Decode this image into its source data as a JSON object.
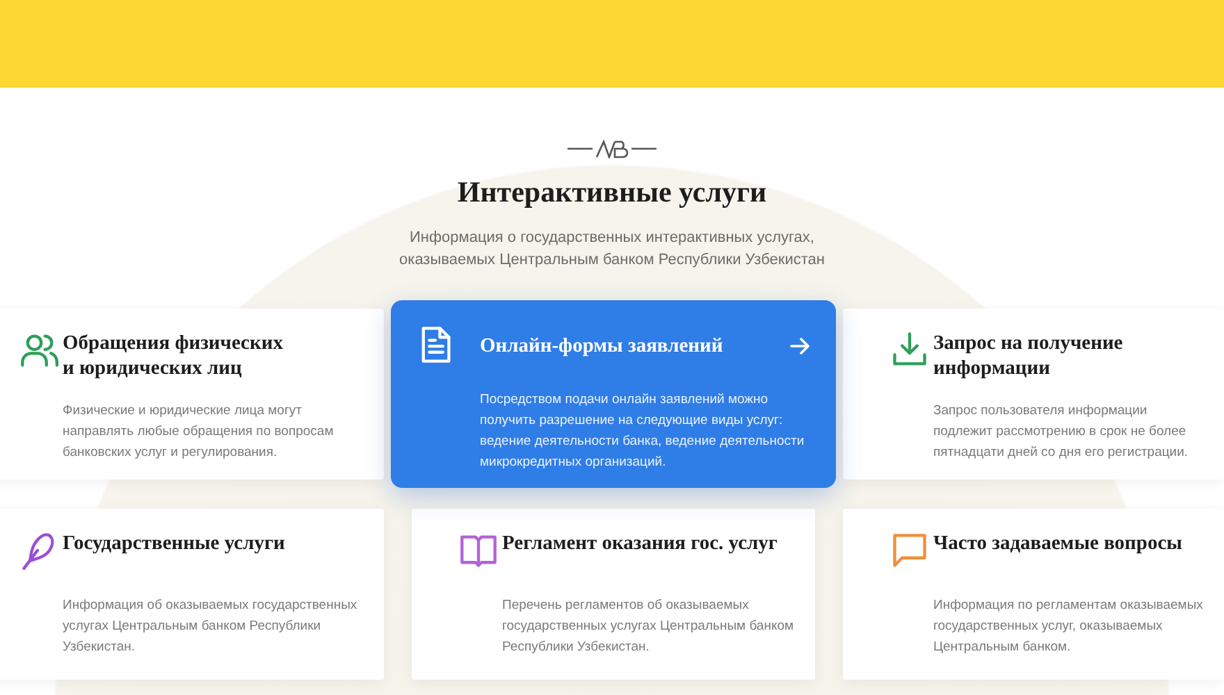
{
  "section": {
    "title": "Интерактивные услуги",
    "subtitle_lines": [
      "Информация о государственных интерактивных услугах,",
      "оказываемых Центральным банком Республики Узбекистан"
    ]
  },
  "services": [
    {
      "kind": "people",
      "color": "#2e9e5b",
      "highlighted": false,
      "title_lines": [
        "Обращения физических",
        "и юридических лиц"
      ],
      "text": "Физические и юридические лица могут направлять любые обращения по вопросам банковских услуг и регулирования."
    },
    {
      "kind": "document",
      "color": "#ffffff",
      "highlighted": true,
      "title_lines": [
        "Онлайн-формы заявлений"
      ],
      "text": "Посредством подачи онлайн заявлений можно получить разрешение на следующие виды услуг: ведение деятельности банка, ведение деятельности микрокредитных организаций."
    },
    {
      "kind": "download",
      "color": "#2e9e5b",
      "highlighted": false,
      "title_lines": [
        "Запрос на получение",
        "информации"
      ],
      "text": "Запрос пользователя информации подлежит рассмотрению в срок не более пятнадцати дней со дня его регистрации."
    },
    {
      "kind": "feather",
      "color": "#9b4fd6",
      "highlighted": false,
      "title_lines": [
        "Государственные услуги"
      ],
      "text": "Информация об оказываемых государственных услугах Центральным банком Республики Узбекистан."
    },
    {
      "kind": "book",
      "color": "#b063d9",
      "highlighted": false,
      "title_lines": [
        "Регламент оказания гос. услуг"
      ],
      "text": "Перечень регламентов об оказываемых государственных услугах Центральным банком Республики Узбекистан."
    },
    {
      "kind": "chat",
      "color": "#ef8f3c",
      "highlighted": false,
      "title_lines": [
        "Часто задаваемые вопросы"
      ],
      "text": "Информация по регламентам оказываемых государственных услуг, оказываемых Центральным банком."
    }
  ]
}
